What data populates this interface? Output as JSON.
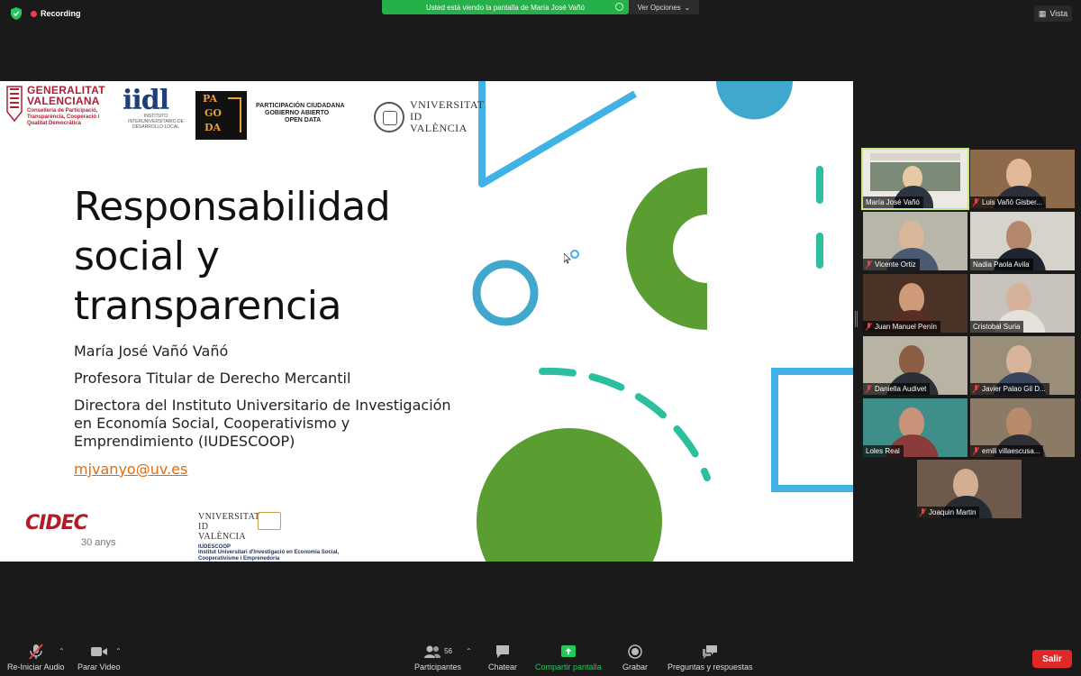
{
  "meeting": {
    "recording_label": "Recording",
    "share_banner": "Usted está viendo la pantalla de María José Vañó",
    "view_options": "Ver Opciones",
    "view_label": "Vista",
    "accent_green": "#25b04a",
    "leave_red": "#e02828"
  },
  "slide": {
    "logos": {
      "generalitat_name": "GENERALITAT VALENCIANA",
      "generalitat_sub": "Conselleria de Participació, Transparència, Cooperació i Qualitat Democràtica",
      "iidl_mark": "iidl",
      "iidl_sub": "INSTITUTO INTERUNIVERSITARIO DE DESARROLLO LOCAL",
      "pagoda_letters": [
        "PA",
        "GO",
        "DA"
      ],
      "pc_line1": "PARTICIPACIÓN CIUDADANA",
      "pc_line2": "GOBIERNO ABIERTO",
      "pc_line3": "OPEN DATA",
      "uv_name": "VNIVERSITAT ID VALÈNCIA",
      "cidec": "CIDEC",
      "cidec_years": "30 anys",
      "iudescoop_uv": "VNIVERSITAT ID VALÈNCIA",
      "iudescoop_name": "IUDESCOOP",
      "iudescoop_desc": "Institut Universitari d'Investigació en Economia Social, Cooperativisme i Emprenedoria"
    },
    "title": "Responsabilidad social y transparencia",
    "author": "María José Vañó Vañó",
    "role": "Profesora Titular de Derecho Mercantil",
    "director": "Directora del Instituto Universitario de Investigación en Economía Social, Cooperativismo y Emprendimiento (IUDESCOOP)",
    "email": "mjvanyo@uv.es",
    "colors": {
      "blue": "#40b2e6",
      "green": "#5a9e32",
      "teal": "#2bbf9f",
      "email": "#e36c0a"
    }
  },
  "participants": [
    {
      "name": "María José Vañó",
      "muted": false,
      "active": true
    },
    {
      "name": "Luis Vañó Gisber...",
      "muted": true,
      "active": false
    },
    {
      "name": "Vicente Ortiz",
      "muted": true,
      "active": false
    },
    {
      "name": "Nadia Paola Avila",
      "muted": false,
      "active": false
    },
    {
      "name": "Juan Manuel Penín",
      "muted": true,
      "active": false
    },
    {
      "name": "Cristobal Suria",
      "muted": false,
      "active": false
    },
    {
      "name": "Daniella Audivet",
      "muted": true,
      "active": false
    },
    {
      "name": "Javier Palao Gil D...",
      "muted": true,
      "active": false
    },
    {
      "name": "Loles Real",
      "muted": false,
      "active": false
    },
    {
      "name": "emili villaescusa...",
      "muted": true,
      "active": false
    },
    {
      "name": "Joaquin Martin",
      "muted": true,
      "active": false
    }
  ],
  "toolbar": {
    "audio": "Re-Iniciar Audio",
    "video": "Parar Video",
    "participants": "Participantes",
    "participants_count": "56",
    "chat": "Chatear",
    "share": "Compartir pantalla",
    "record": "Grabar",
    "qa": "Preguntas y respuestas",
    "leave": "Salir"
  }
}
